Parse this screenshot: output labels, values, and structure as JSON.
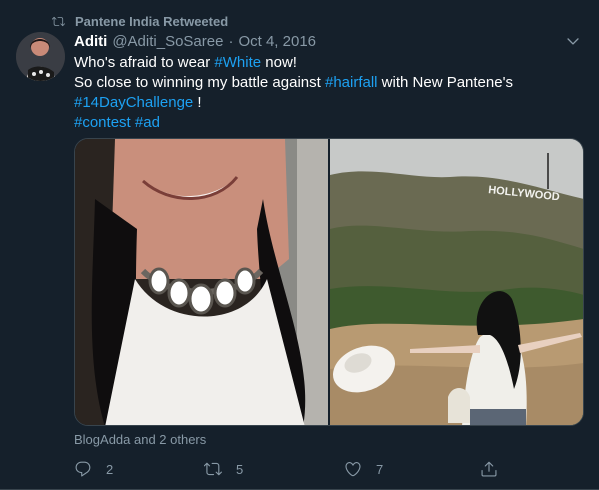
{
  "retweet_context": {
    "text": "Pantene India Retweeted"
  },
  "author": {
    "name": "Aditi",
    "handle": "@Aditi_SoSaree",
    "separator": "·",
    "date": "Oct 4, 2016"
  },
  "tweet": {
    "line1_a": "Who's afraid to wear ",
    "line1_link": "#White",
    "line1_b": " now!",
    "line2_a": "So close to winning my battle against ",
    "line2_link": "#hairfall",
    "line2_b": " with New Pantene's",
    "line3_link": "#14DayChallenge",
    "line3_b": " !",
    "line4_link1": "#contest",
    "line4_space": " ",
    "line4_link2": "#ad"
  },
  "media": {
    "left_photo": "woman-white-necklace-photo",
    "right_photo": "hollywood-sign-photo",
    "right_sign_text": "HOLLYWOOD"
  },
  "likers_text": "BlogAdda and 2 others",
  "actions": {
    "reply_count": "2",
    "retweet_count": "5",
    "like_count": "7"
  },
  "colors": {
    "background": "#15202b",
    "link": "#1da1f2",
    "muted": "#8899a6"
  },
  "icons": [
    "retweet-icon",
    "chevron-down-icon",
    "reply-icon",
    "retweet-icon",
    "like-icon",
    "share-icon"
  ]
}
